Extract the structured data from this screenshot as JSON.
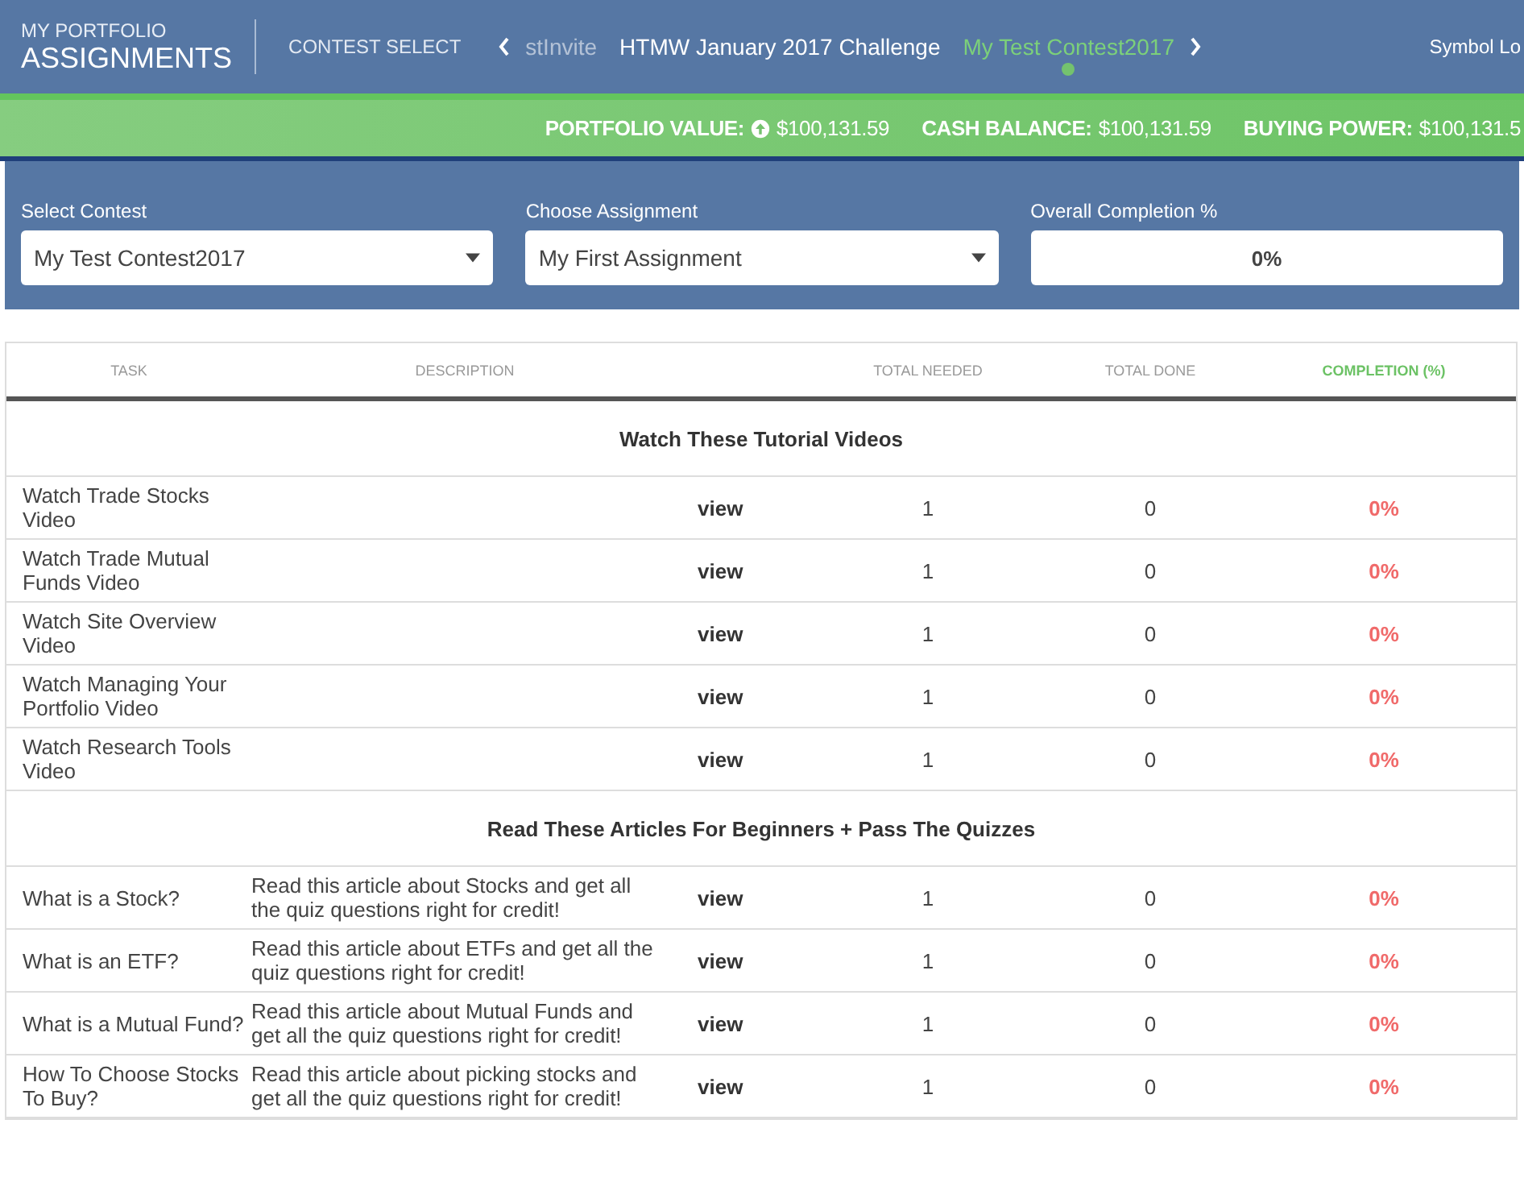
{
  "header": {
    "subtitle": "MY PORTFOLIO",
    "title": "ASSIGNMENTS",
    "contest_select_label": "CONTEST SELECT",
    "tabs": [
      {
        "label": "stInvite",
        "selected": false,
        "faded": true
      },
      {
        "label": "HTMW January 2017 Challenge",
        "selected": false,
        "faded": false
      },
      {
        "label": "My Test Contest2017",
        "selected": true,
        "faded": false
      }
    ],
    "symbol_lookup": "Symbol Lo"
  },
  "stats": [
    {
      "label": "PORTFOLIO VALUE:",
      "value": "$100,131.59",
      "up": true
    },
    {
      "label": "CASH BALANCE:",
      "value": "$100,131.59"
    },
    {
      "label": "BUYING POWER:",
      "value": "$100,131.5"
    }
  ],
  "filters": [
    {
      "label": "Select Contest",
      "value": "My Test Contest2017",
      "kind": "select"
    },
    {
      "label": "Choose Assignment",
      "value": "My First Assignment",
      "kind": "select"
    },
    {
      "label": "Overall Completion %",
      "value": "0%",
      "kind": "display"
    }
  ],
  "table": {
    "columns": [
      "TASK",
      "DESCRIPTION",
      "TOTAL NEEDED",
      "TOTAL DONE",
      "COMPLETION (%)"
    ],
    "sections": [
      {
        "title": "Watch These Tutorial Videos",
        "rows": [
          {
            "task": "Watch Trade Stocks Video",
            "description": "",
            "link": "view",
            "needed": "1",
            "done": "0",
            "completion": "0%"
          },
          {
            "task": "Watch Trade Mutual Funds Video",
            "description": "",
            "link": "view",
            "needed": "1",
            "done": "0",
            "completion": "0%"
          },
          {
            "task": "Watch Site Overview Video",
            "description": "",
            "link": "view",
            "needed": "1",
            "done": "0",
            "completion": "0%"
          },
          {
            "task": "Watch Managing Your Portfolio Video",
            "description": "",
            "link": "view",
            "needed": "1",
            "done": "0",
            "completion": "0%"
          },
          {
            "task": "Watch Research Tools Video",
            "description": "",
            "link": "view",
            "needed": "1",
            "done": "0",
            "completion": "0%"
          }
        ]
      },
      {
        "title": "Read These Articles For Beginners + Pass The Quizzes",
        "rows": [
          {
            "task": "What is a Stock?",
            "description": "Read this article about Stocks and get all the quiz questions right for credit!",
            "link": "view",
            "needed": "1",
            "done": "0",
            "completion": "0%"
          },
          {
            "task": "What is an ETF?",
            "description": "Read this article about ETFs and get all the quiz questions right for credit!",
            "link": "view",
            "needed": "1",
            "done": "0",
            "completion": "0%"
          },
          {
            "task": "What is a Mutual Fund?",
            "description": "Read this article about Mutual Funds and get all the quiz questions right for credit!",
            "link": "view",
            "needed": "1",
            "done": "0",
            "completion": "0%"
          },
          {
            "task": "How To Choose Stocks To Buy?",
            "description": "Read this article about picking stocks and get all the quiz questions right for credit!",
            "link": "view",
            "needed": "1",
            "done": "0",
            "completion": "0%"
          }
        ]
      }
    ]
  }
}
